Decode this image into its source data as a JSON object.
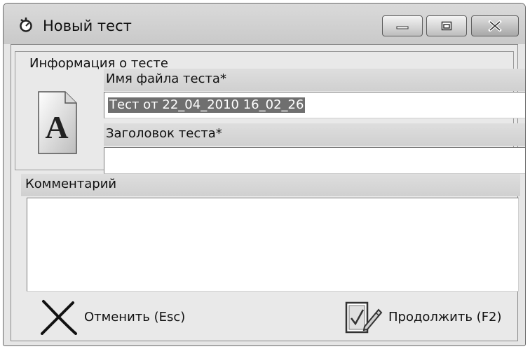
{
  "window": {
    "title": "Новый тест"
  },
  "group": {
    "title": "Информация о тесте"
  },
  "fields": {
    "filename_label": "Имя файла теста*",
    "filename_value": "Тест от 22_04_2010 16_02_26",
    "heading_label": "Заголовок теста*",
    "heading_value": "",
    "comment_label": "Комментарий",
    "comment_value": ""
  },
  "icons": {
    "app": "app-icon",
    "document": "document-a-icon",
    "cancel": "cross-icon",
    "continue": "checklist-pen-icon",
    "doc_glyph": "A"
  },
  "buttons": {
    "cancel_label": "Отменить (Esc)",
    "continue_label": "Продолжить (F2)"
  },
  "colors": {
    "selection": "#6f6f6f",
    "window_bg": "#e6e6e6"
  }
}
